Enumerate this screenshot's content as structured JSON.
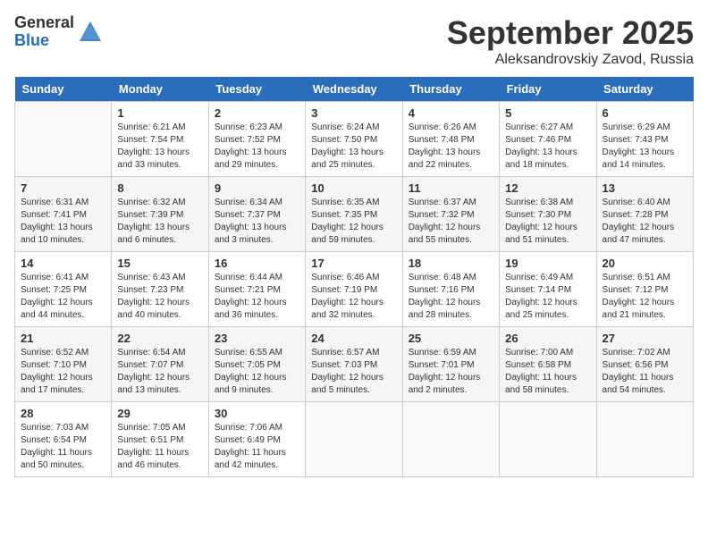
{
  "header": {
    "logo_general": "General",
    "logo_blue": "Blue",
    "month_title": "September 2025",
    "location": "Aleksandrovskiy Zavod, Russia"
  },
  "days_of_week": [
    "Sunday",
    "Monday",
    "Tuesday",
    "Wednesday",
    "Thursday",
    "Friday",
    "Saturday"
  ],
  "weeks": [
    [
      {
        "day": "",
        "sunrise": "",
        "sunset": "",
        "daylight": ""
      },
      {
        "day": "1",
        "sunrise": "Sunrise: 6:21 AM",
        "sunset": "Sunset: 7:54 PM",
        "daylight": "Daylight: 13 hours and 33 minutes."
      },
      {
        "day": "2",
        "sunrise": "Sunrise: 6:23 AM",
        "sunset": "Sunset: 7:52 PM",
        "daylight": "Daylight: 13 hours and 29 minutes."
      },
      {
        "day": "3",
        "sunrise": "Sunrise: 6:24 AM",
        "sunset": "Sunset: 7:50 PM",
        "daylight": "Daylight: 13 hours and 25 minutes."
      },
      {
        "day": "4",
        "sunrise": "Sunrise: 6:26 AM",
        "sunset": "Sunset: 7:48 PM",
        "daylight": "Daylight: 13 hours and 22 minutes."
      },
      {
        "day": "5",
        "sunrise": "Sunrise: 6:27 AM",
        "sunset": "Sunset: 7:46 PM",
        "daylight": "Daylight: 13 hours and 18 minutes."
      },
      {
        "day": "6",
        "sunrise": "Sunrise: 6:29 AM",
        "sunset": "Sunset: 7:43 PM",
        "daylight": "Daylight: 13 hours and 14 minutes."
      }
    ],
    [
      {
        "day": "7",
        "sunrise": "Sunrise: 6:31 AM",
        "sunset": "Sunset: 7:41 PM",
        "daylight": "Daylight: 13 hours and 10 minutes."
      },
      {
        "day": "8",
        "sunrise": "Sunrise: 6:32 AM",
        "sunset": "Sunset: 7:39 PM",
        "daylight": "Daylight: 13 hours and 6 minutes."
      },
      {
        "day": "9",
        "sunrise": "Sunrise: 6:34 AM",
        "sunset": "Sunset: 7:37 PM",
        "daylight": "Daylight: 13 hours and 3 minutes."
      },
      {
        "day": "10",
        "sunrise": "Sunrise: 6:35 AM",
        "sunset": "Sunset: 7:35 PM",
        "daylight": "Daylight: 12 hours and 59 minutes."
      },
      {
        "day": "11",
        "sunrise": "Sunrise: 6:37 AM",
        "sunset": "Sunset: 7:32 PM",
        "daylight": "Daylight: 12 hours and 55 minutes."
      },
      {
        "day": "12",
        "sunrise": "Sunrise: 6:38 AM",
        "sunset": "Sunset: 7:30 PM",
        "daylight": "Daylight: 12 hours and 51 minutes."
      },
      {
        "day": "13",
        "sunrise": "Sunrise: 6:40 AM",
        "sunset": "Sunset: 7:28 PM",
        "daylight": "Daylight: 12 hours and 47 minutes."
      }
    ],
    [
      {
        "day": "14",
        "sunrise": "Sunrise: 6:41 AM",
        "sunset": "Sunset: 7:25 PM",
        "daylight": "Daylight: 12 hours and 44 minutes."
      },
      {
        "day": "15",
        "sunrise": "Sunrise: 6:43 AM",
        "sunset": "Sunset: 7:23 PM",
        "daylight": "Daylight: 12 hours and 40 minutes."
      },
      {
        "day": "16",
        "sunrise": "Sunrise: 6:44 AM",
        "sunset": "Sunset: 7:21 PM",
        "daylight": "Daylight: 12 hours and 36 minutes."
      },
      {
        "day": "17",
        "sunrise": "Sunrise: 6:46 AM",
        "sunset": "Sunset: 7:19 PM",
        "daylight": "Daylight: 12 hours and 32 minutes."
      },
      {
        "day": "18",
        "sunrise": "Sunrise: 6:48 AM",
        "sunset": "Sunset: 7:16 PM",
        "daylight": "Daylight: 12 hours and 28 minutes."
      },
      {
        "day": "19",
        "sunrise": "Sunrise: 6:49 AM",
        "sunset": "Sunset: 7:14 PM",
        "daylight": "Daylight: 12 hours and 25 minutes."
      },
      {
        "day": "20",
        "sunrise": "Sunrise: 6:51 AM",
        "sunset": "Sunset: 7:12 PM",
        "daylight": "Daylight: 12 hours and 21 minutes."
      }
    ],
    [
      {
        "day": "21",
        "sunrise": "Sunrise: 6:52 AM",
        "sunset": "Sunset: 7:10 PM",
        "daylight": "Daylight: 12 hours and 17 minutes."
      },
      {
        "day": "22",
        "sunrise": "Sunrise: 6:54 AM",
        "sunset": "Sunset: 7:07 PM",
        "daylight": "Daylight: 12 hours and 13 minutes."
      },
      {
        "day": "23",
        "sunrise": "Sunrise: 6:55 AM",
        "sunset": "Sunset: 7:05 PM",
        "daylight": "Daylight: 12 hours and 9 minutes."
      },
      {
        "day": "24",
        "sunrise": "Sunrise: 6:57 AM",
        "sunset": "Sunset: 7:03 PM",
        "daylight": "Daylight: 12 hours and 5 minutes."
      },
      {
        "day": "25",
        "sunrise": "Sunrise: 6:59 AM",
        "sunset": "Sunset: 7:01 PM",
        "daylight": "Daylight: 12 hours and 2 minutes."
      },
      {
        "day": "26",
        "sunrise": "Sunrise: 7:00 AM",
        "sunset": "Sunset: 6:58 PM",
        "daylight": "Daylight: 11 hours and 58 minutes."
      },
      {
        "day": "27",
        "sunrise": "Sunrise: 7:02 AM",
        "sunset": "Sunset: 6:56 PM",
        "daylight": "Daylight: 11 hours and 54 minutes."
      }
    ],
    [
      {
        "day": "28",
        "sunrise": "Sunrise: 7:03 AM",
        "sunset": "Sunset: 6:54 PM",
        "daylight": "Daylight: 11 hours and 50 minutes."
      },
      {
        "day": "29",
        "sunrise": "Sunrise: 7:05 AM",
        "sunset": "Sunset: 6:51 PM",
        "daylight": "Daylight: 11 hours and 46 minutes."
      },
      {
        "day": "30",
        "sunrise": "Sunrise: 7:06 AM",
        "sunset": "Sunset: 6:49 PM",
        "daylight": "Daylight: 11 hours and 42 minutes."
      },
      {
        "day": "",
        "sunrise": "",
        "sunset": "",
        "daylight": ""
      },
      {
        "day": "",
        "sunrise": "",
        "sunset": "",
        "daylight": ""
      },
      {
        "day": "",
        "sunrise": "",
        "sunset": "",
        "daylight": ""
      },
      {
        "day": "",
        "sunrise": "",
        "sunset": "",
        "daylight": ""
      }
    ]
  ]
}
